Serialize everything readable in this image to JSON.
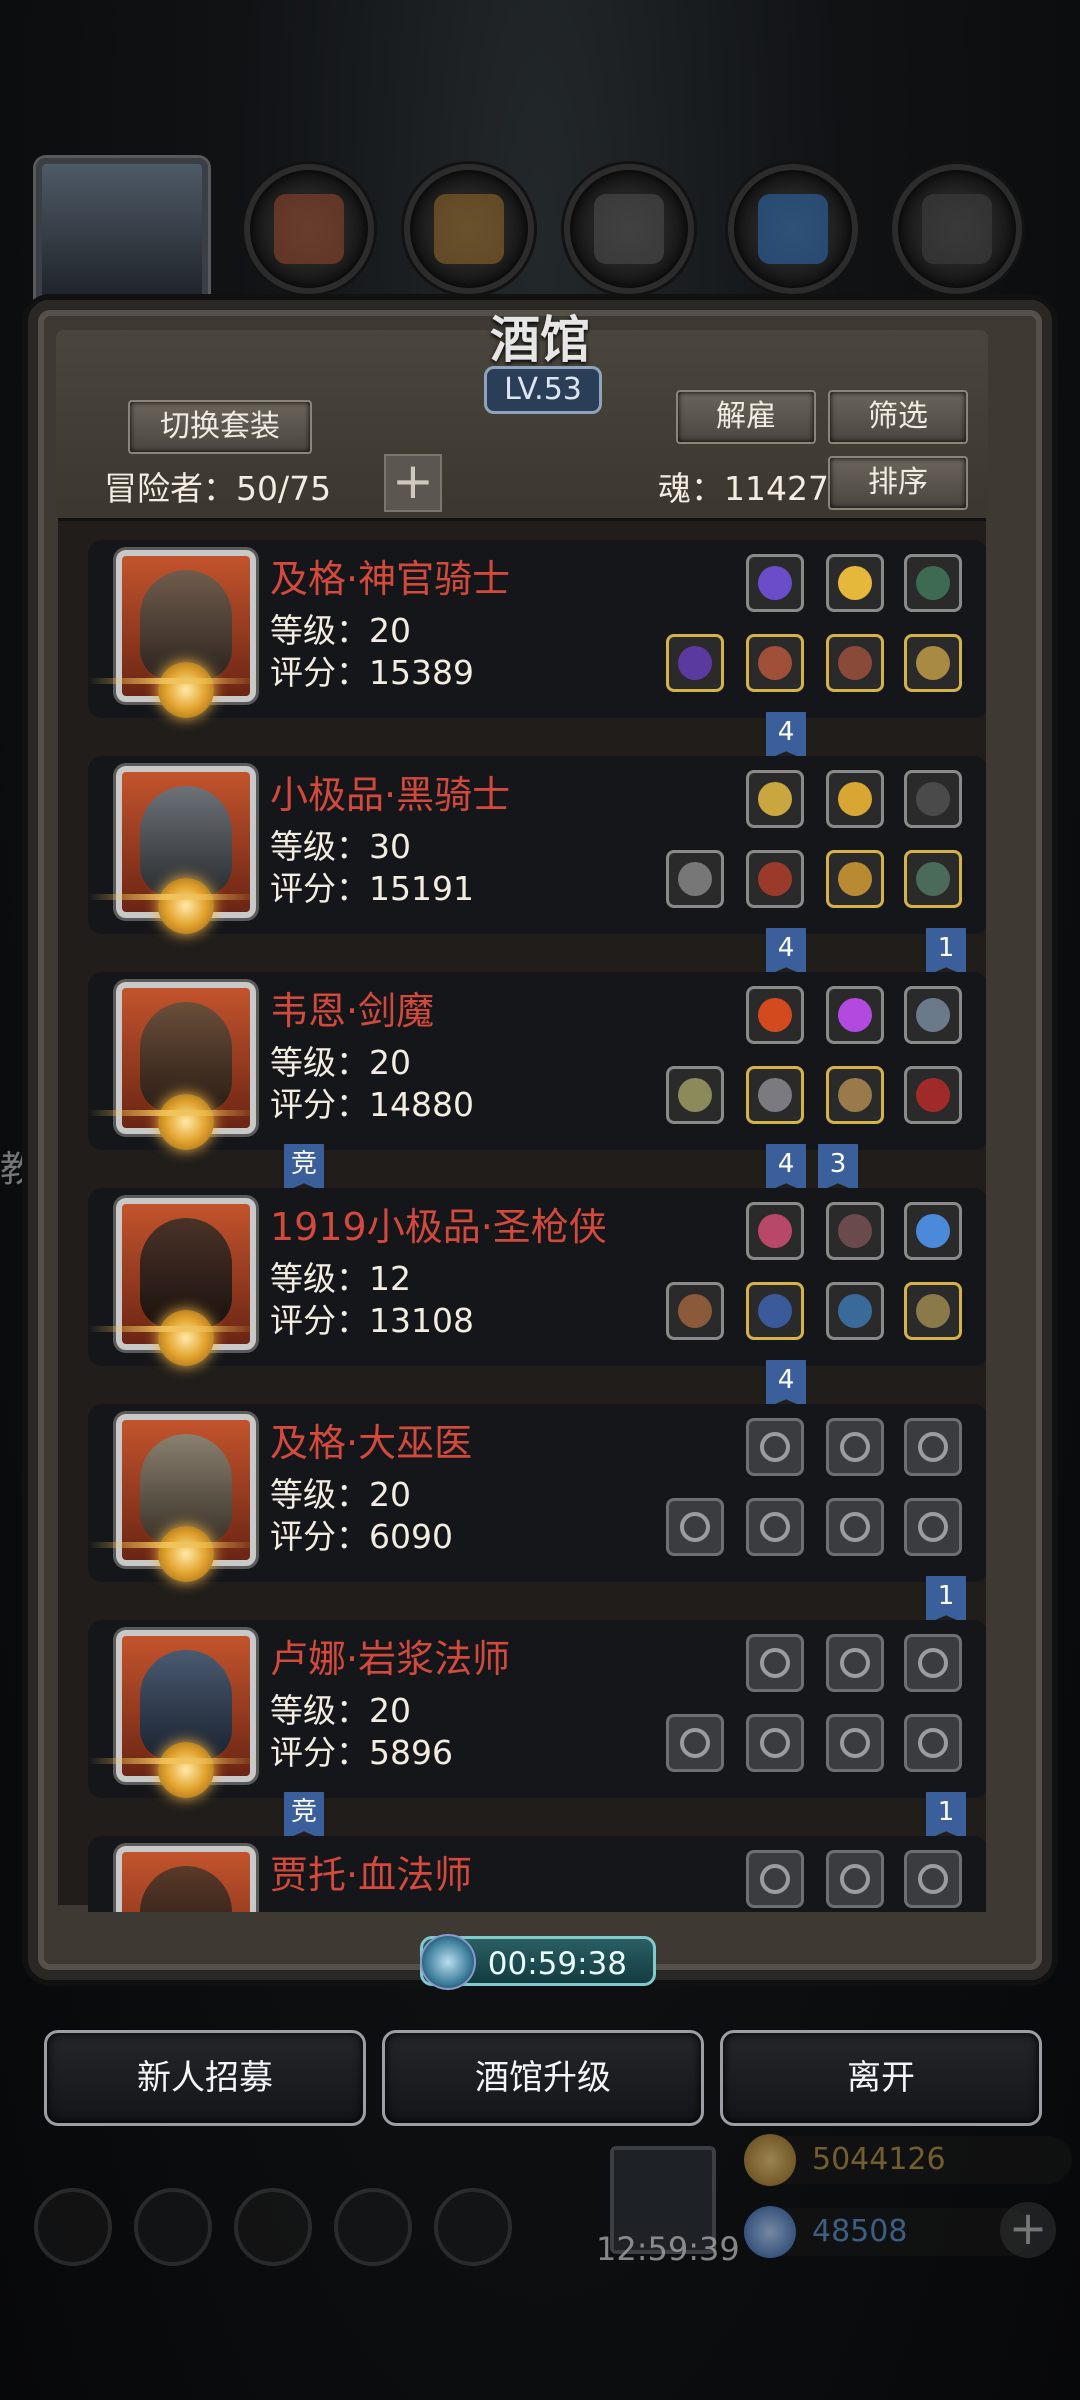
{
  "window": {
    "title": "酒馆",
    "level": "LV.53"
  },
  "header": {
    "switch_set": "切换套装",
    "dismiss": "解雇",
    "filter": "筛选",
    "sort": "排序",
    "adventurers_label": "冒险者：50/75",
    "soul_label": "魂：11427",
    "plus": "+"
  },
  "side_text": "教",
  "heroes": [
    {
      "name": "及格·神官骑士",
      "level": "等级：20",
      "score": "评分：15389",
      "flags": [
        {
          "text": "4"
        }
      ]
    },
    {
      "name": "小极品·黑骑士",
      "level": "等级：30",
      "score": "评分：15191",
      "flags": [
        {
          "text": "4"
        },
        {
          "text": "1"
        }
      ]
    },
    {
      "name": "韦恩·剑魔",
      "level": "等级：20",
      "score": "评分：14880",
      "flags": [
        {
          "text": "竞"
        },
        {
          "text": "4"
        },
        {
          "text": "3"
        }
      ]
    },
    {
      "name": "1919小极品·圣枪侠",
      "level": "等级：12",
      "score": "评分：13108",
      "flags": [
        {
          "text": "4"
        }
      ]
    },
    {
      "name": "及格·大巫医",
      "level": "等级：20",
      "score": "评分：6090",
      "flags": [
        {
          "text": "1"
        }
      ]
    },
    {
      "name": "卢娜·岩浆法师",
      "level": "等级：20",
      "score": "评分：5896",
      "flags": [
        {
          "text": "竞"
        },
        {
          "text": "1"
        }
      ]
    },
    {
      "name": "贾托·血法师",
      "level": "",
      "score": "",
      "flags": []
    }
  ],
  "timer": "00:59:38",
  "bottom": {
    "recruit": "新人招募",
    "upgrade": "酒馆升级",
    "leave": "离开"
  },
  "currency": {
    "gold": "5044126",
    "gems": "48508"
  },
  "gift_timer": "12:59:39",
  "colors": {
    "hero_name": "#d3493c",
    "flag": "#3b5f9a",
    "timer": "#80c9cc"
  }
}
